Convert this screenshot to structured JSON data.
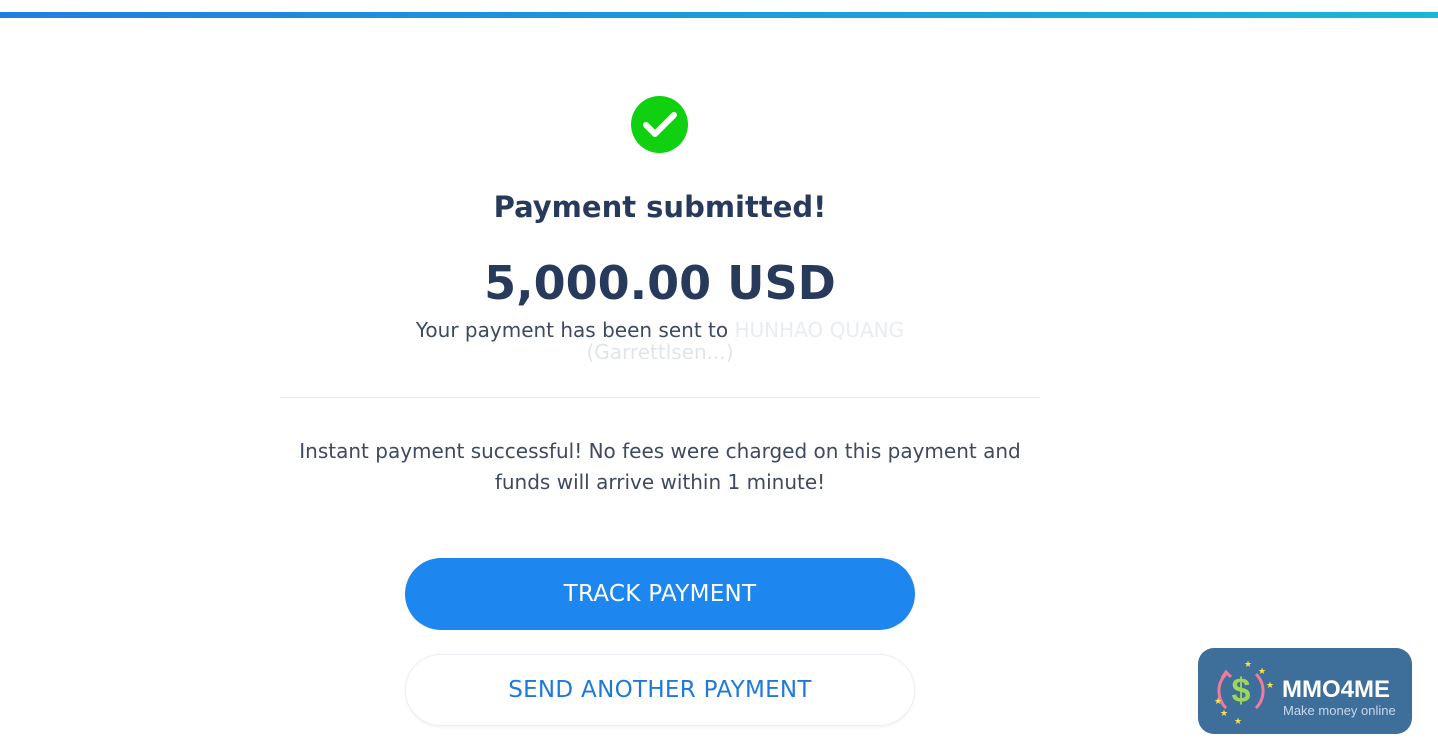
{
  "header": {
    "accent_gradient": [
      "#1f7fe0",
      "#19b6d6"
    ]
  },
  "status": {
    "icon": "check-circle-icon",
    "icon_color": "#0fd10f",
    "title": "Payment submitted!"
  },
  "payment": {
    "amount": "5,000.00 USD",
    "sent_prefix": "Your payment has been sent to",
    "recipient_name": "HUNHAO QUANG",
    "recipient_email": "(Garrettlsen...)"
  },
  "message": {
    "line1": "Instant payment successful! No fees were charged on this payment and",
    "line2": "funds will arrive within 1 minute!"
  },
  "actions": {
    "track_label": "TRACK PAYMENT",
    "track_color": "#1e86ef",
    "send_another_label": "SEND ANOTHER PAYMENT",
    "send_another_color": "#1e7ad6"
  },
  "watermark": {
    "brand": "MMO4ME",
    "tagline": "Make money online",
    "background": "#3e6e9a"
  }
}
